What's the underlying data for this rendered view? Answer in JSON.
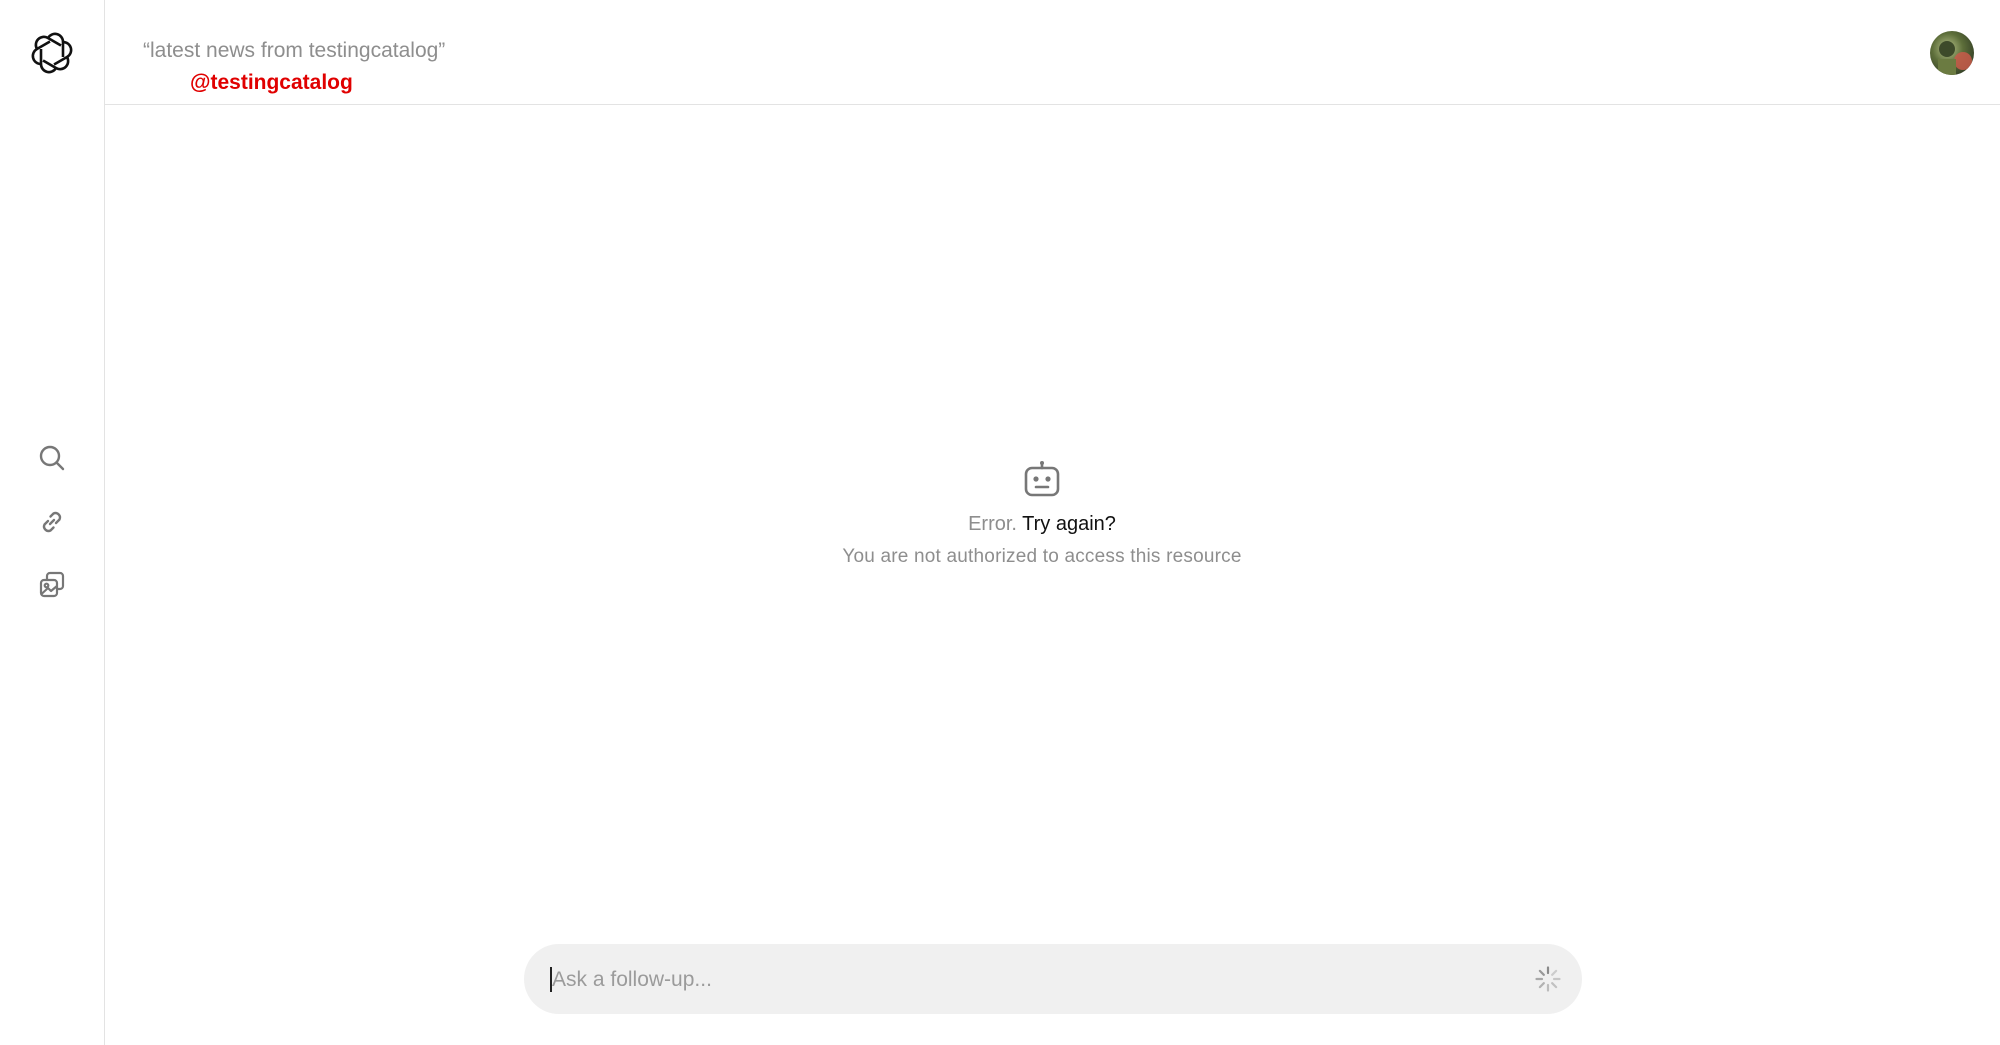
{
  "header": {
    "query": "“latest news from testingcatalog”",
    "watermark": "@testingcatalog"
  },
  "sidebar": {
    "logo": "openai-logo-icon",
    "items": [
      {
        "icon": "search-icon"
      },
      {
        "icon": "link-icon"
      },
      {
        "icon": "images-icon"
      }
    ]
  },
  "error": {
    "icon": "robot-icon",
    "label": "Error.",
    "retry_label": "Try again?",
    "message": "You are not authorized to access this resource"
  },
  "followup": {
    "placeholder": "Ask a follow-up...",
    "status_icon": "loading-spinner-icon"
  },
  "colors": {
    "watermark": "#e00000",
    "muted_text": "#8e8e8e",
    "input_bg": "#f0f0f0",
    "border": "#e3e3e3"
  }
}
